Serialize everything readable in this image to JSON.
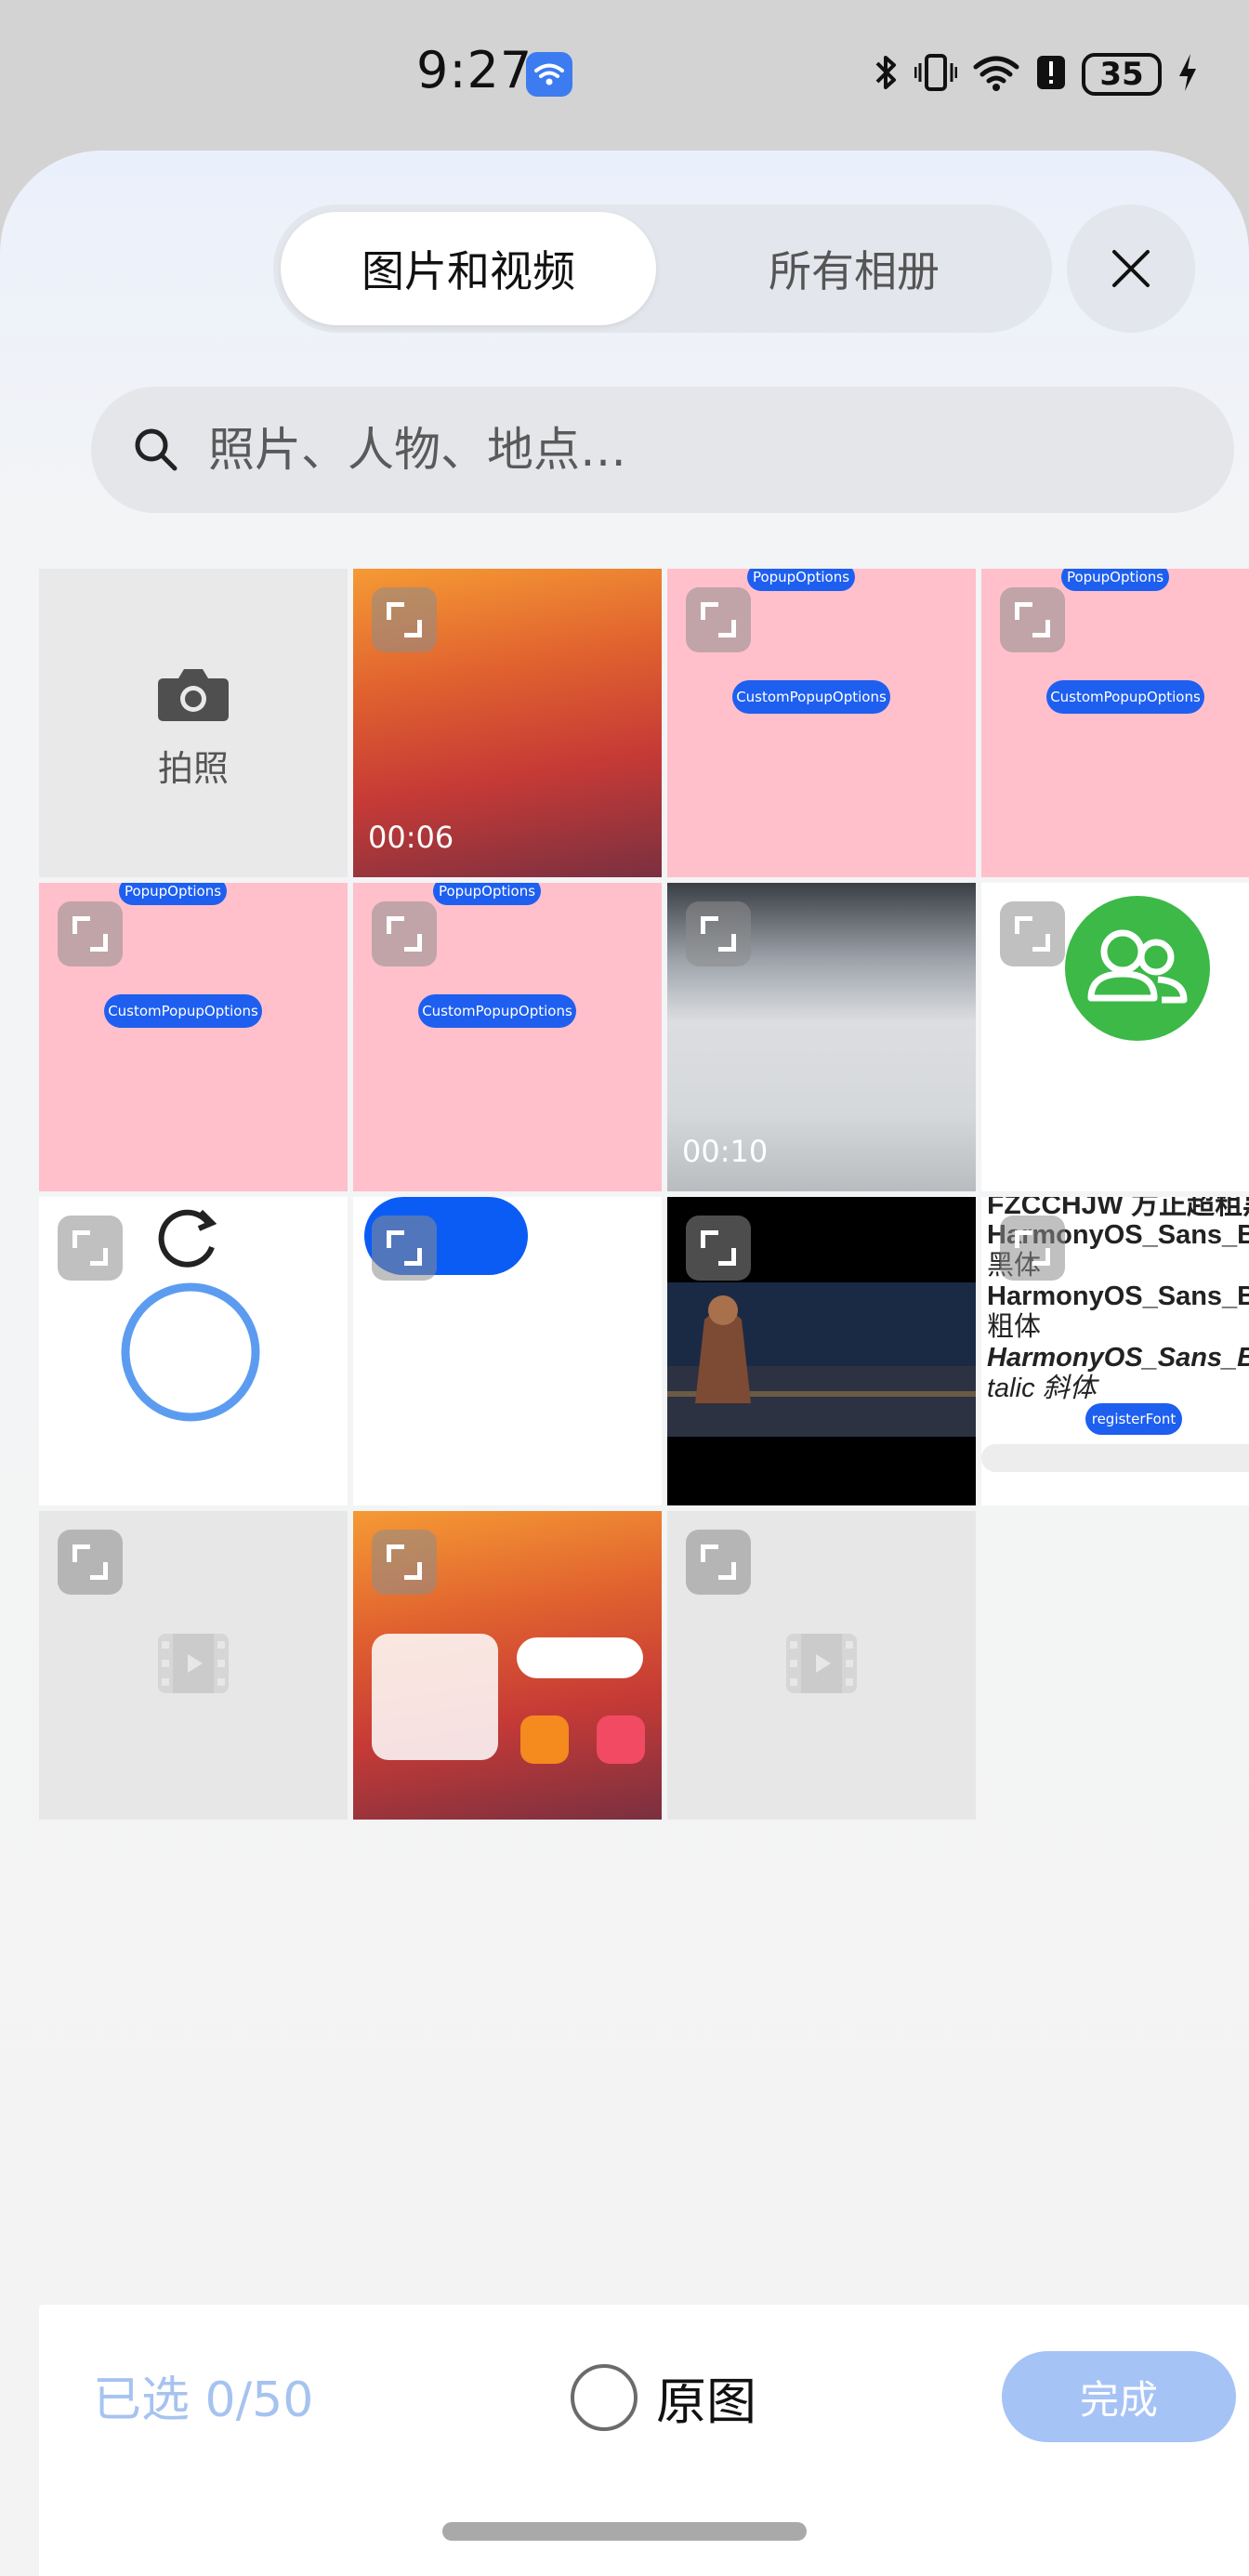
{
  "status_bar": {
    "time": "9:27",
    "battery": "35",
    "icons": [
      "wifi-badge-icon",
      "bluetooth-icon",
      "vibrate-icon",
      "wifi-icon",
      "alert-icon",
      "battery-icon",
      "charging-icon"
    ]
  },
  "header": {
    "tabs": [
      {
        "label": "图片和视频",
        "active": true
      },
      {
        "label": "所有相册",
        "active": false
      }
    ],
    "close_icon": "close-icon"
  },
  "search": {
    "placeholder": "照片、人物、地点…"
  },
  "grid": {
    "camera_label": "拍照",
    "items": [
      {
        "type": "camera"
      },
      {
        "type": "video",
        "duration": "00:06"
      },
      {
        "type": "image",
        "chips": [
          "PopupOptions",
          "CustomPopupOptions"
        ]
      },
      {
        "type": "image",
        "chips": [
          "PopupOptions",
          "CustomPopupOptions"
        ]
      },
      {
        "type": "image",
        "chips": [
          "PopupOptions",
          "CustomPopupOptions"
        ]
      },
      {
        "type": "image",
        "chips": [
          "PopupOptions",
          "CustomPopupOptions"
        ]
      },
      {
        "type": "video",
        "duration": "00:10"
      },
      {
        "type": "image",
        "icon": "contacts-icon"
      },
      {
        "type": "image",
        "icon": "refresh-icon"
      },
      {
        "type": "image",
        "icon": "toggle-icon"
      },
      {
        "type": "video",
        "caption": "dark-scene"
      },
      {
        "type": "image",
        "lines": [
          "FZCCHJW 方正超粗黑",
          "HarmonyOS_Sans_Bla",
          "黑体",
          " HarmonyOS_Sans_Bo",
          " 粗体",
          "HarmonyOS_Sans_Bol",
          "talic 斜体"
        ],
        "chip": "registerFont"
      },
      {
        "type": "video",
        "placeholder": true
      },
      {
        "type": "image",
        "caption": "home-screen"
      },
      {
        "type": "video",
        "placeholder": true
      }
    ]
  },
  "bottom": {
    "selected": "已选 0/50",
    "original_label": "原图",
    "done_label": "完成"
  },
  "colors": {
    "accent": "#1e5ff0",
    "disabled_accent": "#a6c3f6",
    "pink": "#ffc0cb"
  }
}
